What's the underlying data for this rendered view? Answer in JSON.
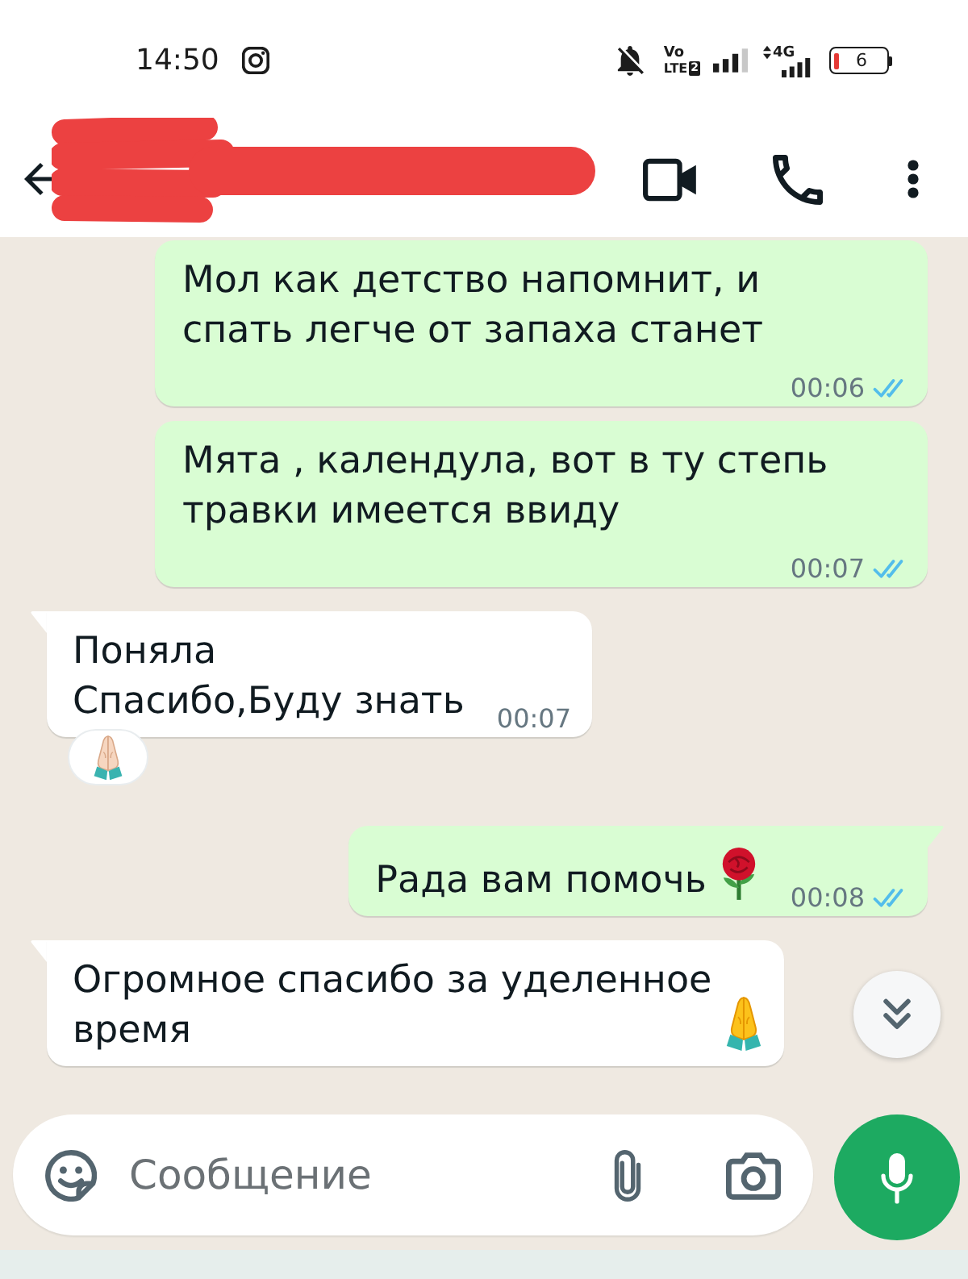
{
  "status_bar": {
    "time": "14:50",
    "volte": {
      "top": "Vo",
      "bottom": "LTE",
      "sim": "2"
    },
    "network": "4G",
    "battery": "6"
  },
  "header": {
    "name_redacted": true
  },
  "messages": [
    {
      "kind": "outgoing",
      "tail": false,
      "text": "Мол как детство напомнит, и\nспать легче от запаха станет",
      "time": "00:06",
      "read": true
    },
    {
      "kind": "outgoing",
      "tail": false,
      "text": "Мята , календула, вот в ту степь\nтравки имеется ввиду",
      "time": "00:07",
      "read": true
    },
    {
      "kind": "incoming",
      "tail": true,
      "text": "Поняла\nСпасибо,Буду знать",
      "time": "00:07",
      "reaction": {
        "kind": "prayer"
      }
    },
    {
      "kind": "outgoing",
      "tail": true,
      "text": "Рада вам помочь",
      "emoji": {
        "kind": "rose"
      },
      "time": "00:08",
      "read": true
    },
    {
      "kind": "incoming",
      "tail": true,
      "text": "Огромное спасибо за уделенное\nвремя",
      "emoji": {
        "kind": "prayer"
      }
    }
  ],
  "scroll_to_bottom_button": true,
  "composer": {
    "placeholder": "Сообщение"
  }
}
